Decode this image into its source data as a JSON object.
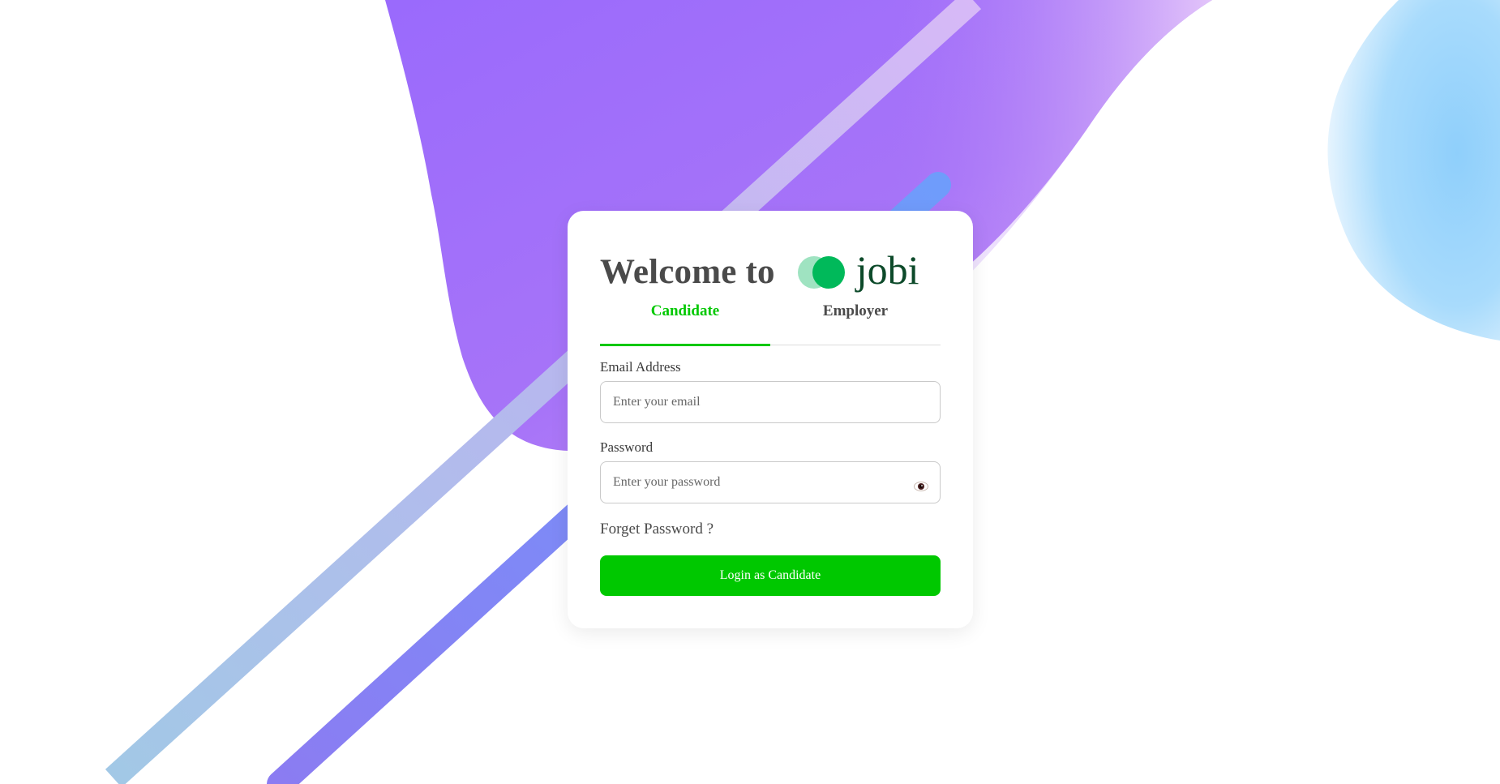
{
  "header": {
    "welcome_text": "Welcome to",
    "logo_text": "jobi"
  },
  "tabs": [
    {
      "label": "Candidate",
      "active": true
    },
    {
      "label": "Employer",
      "active": false
    }
  ],
  "form": {
    "email": {
      "label": "Email Address",
      "placeholder": "Enter your email",
      "value": ""
    },
    "password": {
      "label": "Password",
      "placeholder": "Enter your password",
      "value": ""
    },
    "forget_link": "Forget Password ?",
    "submit_label": "Login as Candidate"
  },
  "colors": {
    "accent": "#00c800",
    "logo_dark": "#00b95a",
    "logo_light": "#9fe3c1",
    "logo_text": "#0d4a2a",
    "heading": "#4a4a4a",
    "blob_purple": "#a06cfb",
    "blob_blue": "#9fd5fb"
  },
  "icons": {
    "password_toggle": "eye-icon",
    "logo_mark": "double-circle-logo-icon"
  }
}
